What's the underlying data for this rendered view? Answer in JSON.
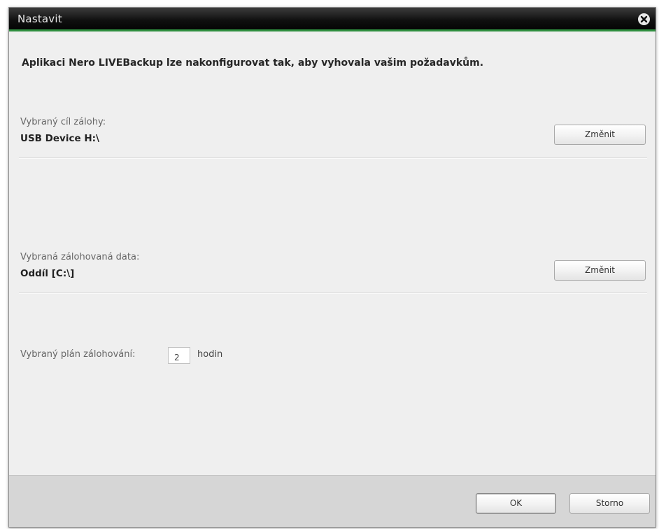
{
  "window": {
    "title": "Nastavit"
  },
  "intro_text": "Aplikaci Nero LIVEBackup lze nakonfigurovat tak, aby vyhovala vašim požadavkům.",
  "target": {
    "label": "Vybraný cíl zálohy:",
    "value": "USB Device H:\\",
    "change_button": "Změnit"
  },
  "data": {
    "label": "Vybraná zálohovaná data:",
    "value": "Oddíl [C:\\]",
    "change_button": "Změnit"
  },
  "schedule": {
    "label": "Vybraný plán zálohování:",
    "hours_value": "2",
    "unit": "hodin"
  },
  "footer": {
    "ok_label": "OK",
    "cancel_label": "Storno"
  },
  "colors": {
    "titlebar": "#0f0f0f",
    "accent_line": "#2f8f3f",
    "dialog_bg": "#efefef",
    "footer_bg": "#d6d6d6"
  },
  "icons": {
    "close": "close-circle-x"
  }
}
